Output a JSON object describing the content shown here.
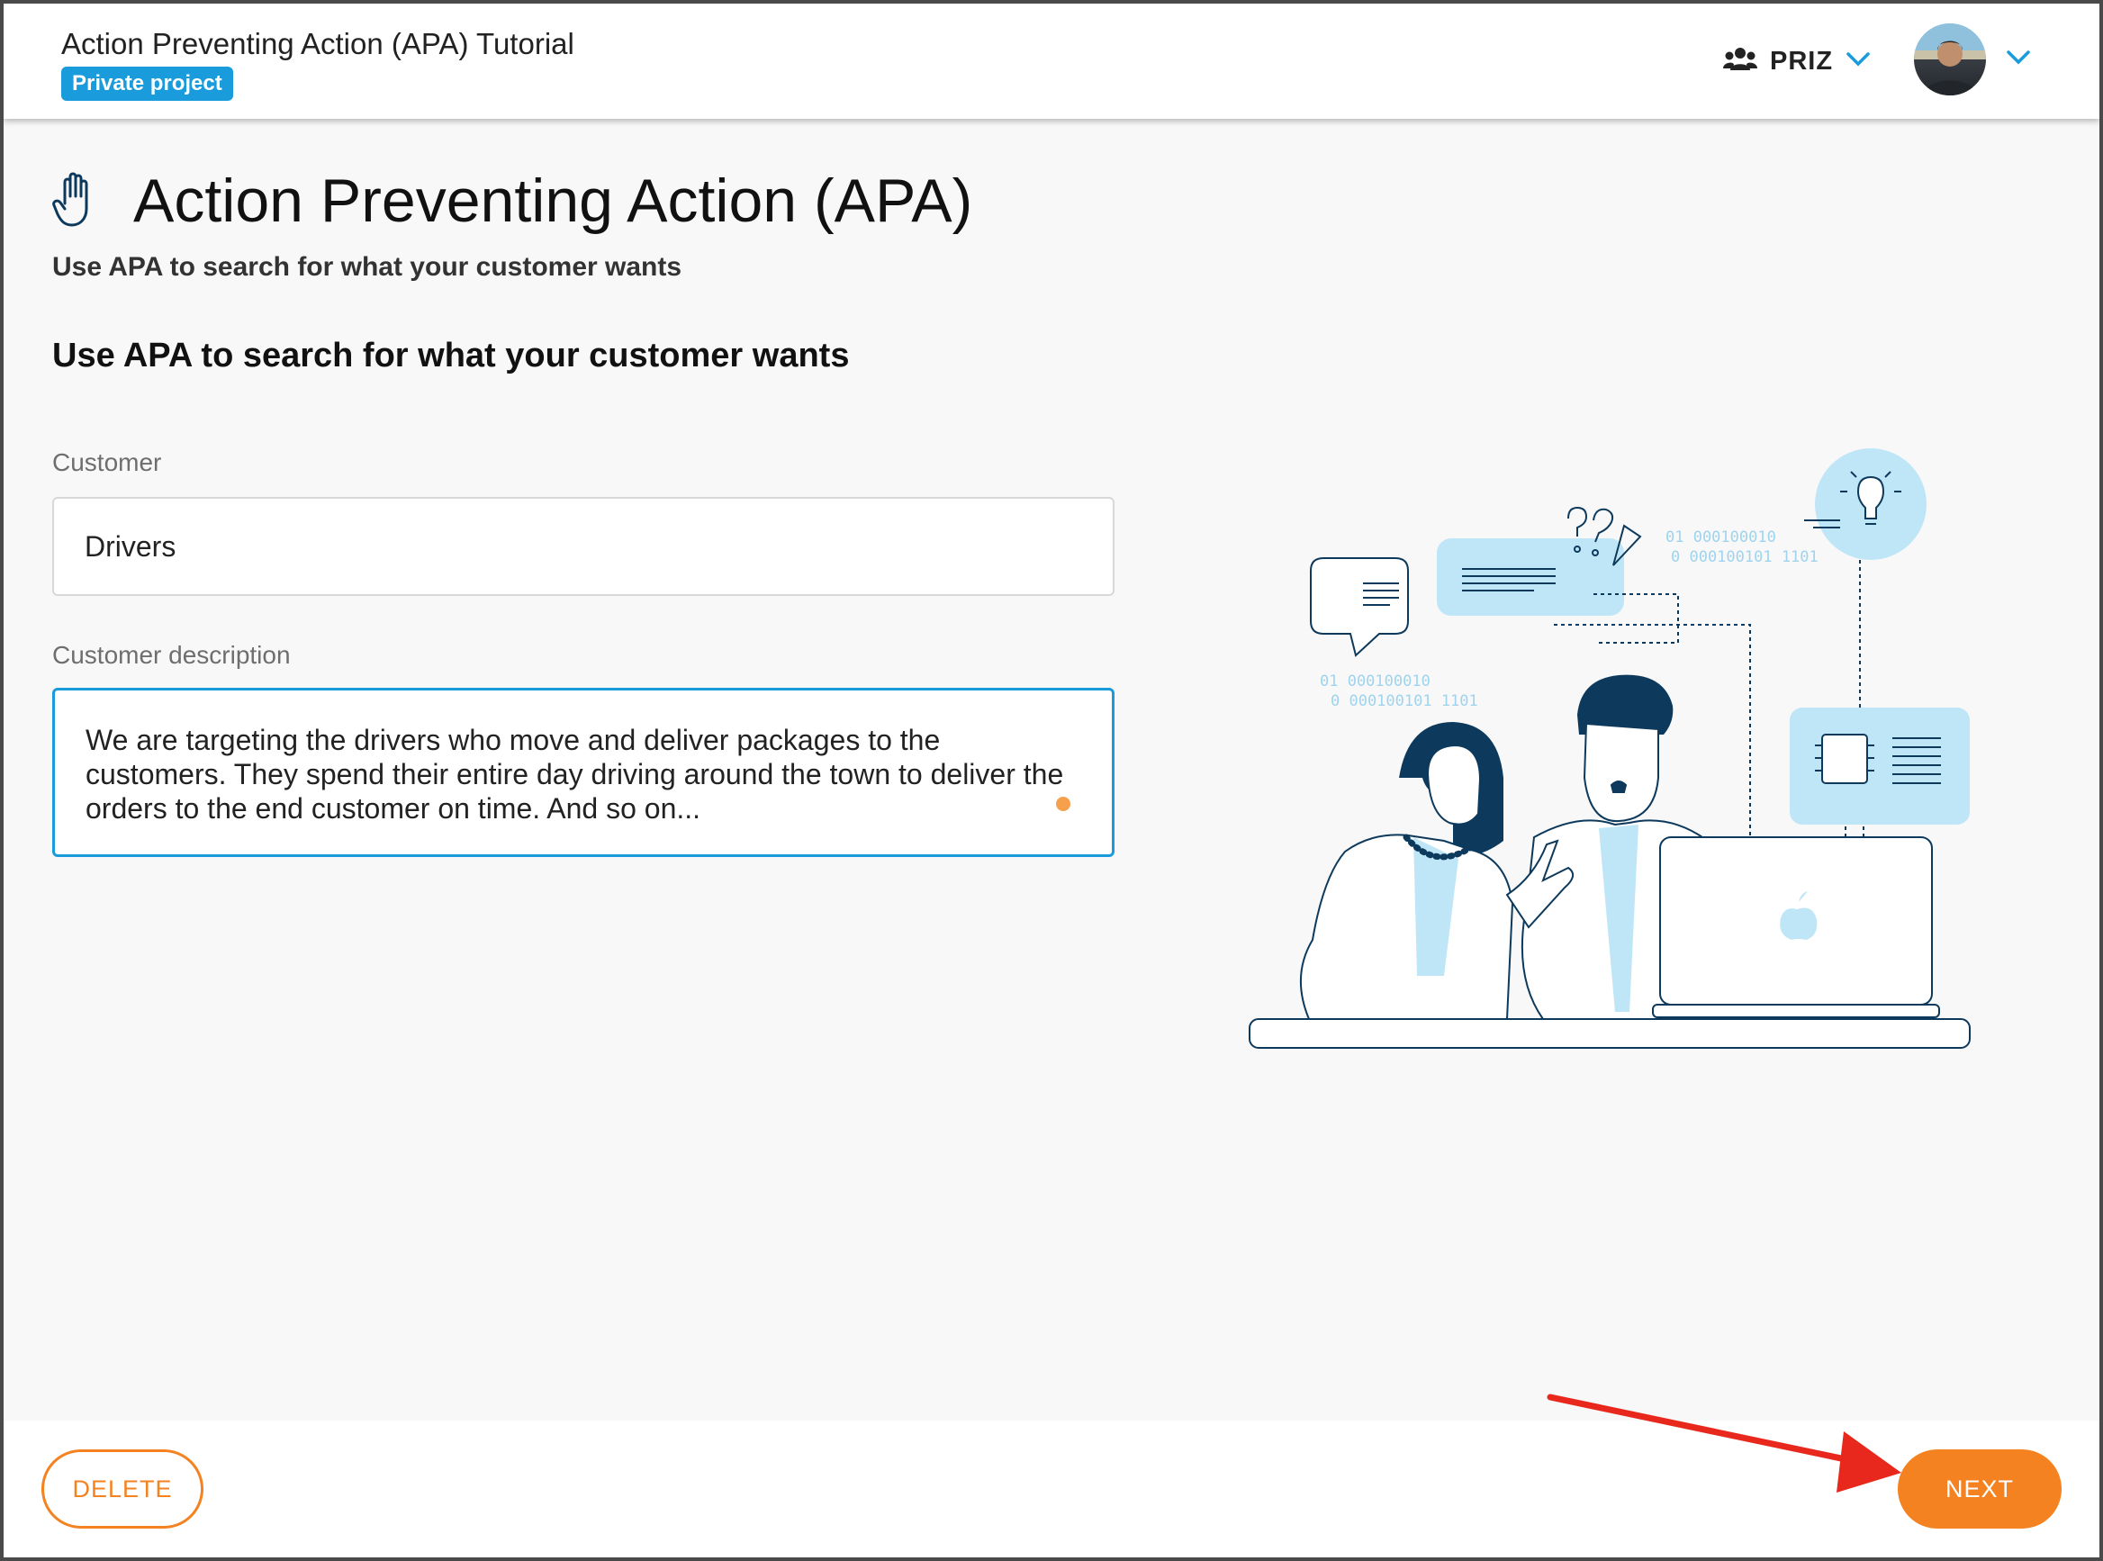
{
  "header": {
    "project_title": "Action Preventing Action (APA) Tutorial",
    "badge": "Private project",
    "team_name": "PRIZ"
  },
  "main": {
    "title": "Action Preventing Action (APA)",
    "subtitle": "Use APA to search for what your customer wants",
    "section_heading": "Use APA to search for what your customer wants",
    "customer": {
      "label": "Customer",
      "value": "Drivers"
    },
    "customer_description": {
      "label": "Customer description",
      "value": "We are targeting the drivers who move and deliver packages to the customers. They spend their entire day driving around the town to deliver the orders to the end customer on time. And so on..."
    }
  },
  "illustration": {
    "binary_top_1": "01    000100010",
    "binary_top_2": "0  000100101   1101",
    "binary_left_1": "01    000100010",
    "binary_left_2": "0  000100101   1101"
  },
  "footer": {
    "delete_label": "DELETE",
    "next_label": "NEXT"
  },
  "colors": {
    "accent_blue": "#1a9bdc",
    "accent_orange": "#f58220",
    "annotation_red": "#e8281c",
    "illustration_light_blue": "#bfe6f7",
    "illustration_navy": "#0d3a5c"
  }
}
